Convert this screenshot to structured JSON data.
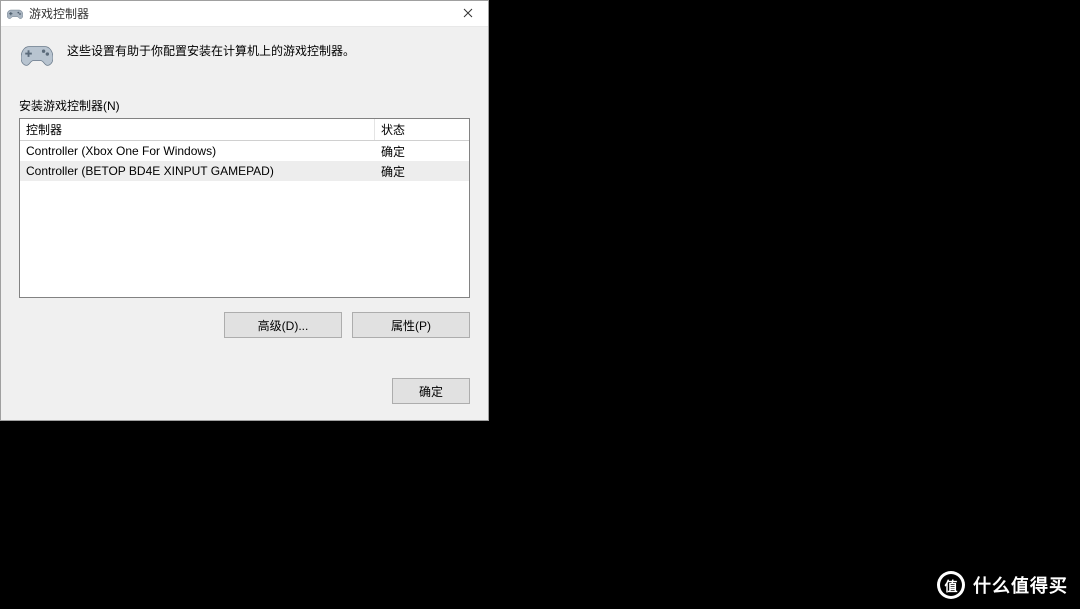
{
  "dialog": {
    "title": "游戏控制器",
    "description": "这些设置有助于你配置安装在计算机上的游戏控制器。",
    "list_label": "安装游戏控制器(N)",
    "columns": {
      "controller": "控制器",
      "status": "状态"
    },
    "rows": [
      {
        "name": "Controller (Xbox One For Windows)",
        "status": "确定",
        "selected": false
      },
      {
        "name": "Controller (BETOP BD4E XINPUT GAMEPAD)",
        "status": "确定",
        "selected": true
      }
    ],
    "buttons": {
      "advanced": "高级(D)...",
      "properties": "属性(P)",
      "ok": "确定"
    }
  },
  "watermark": {
    "badge": "值",
    "text": "什么值得买"
  }
}
